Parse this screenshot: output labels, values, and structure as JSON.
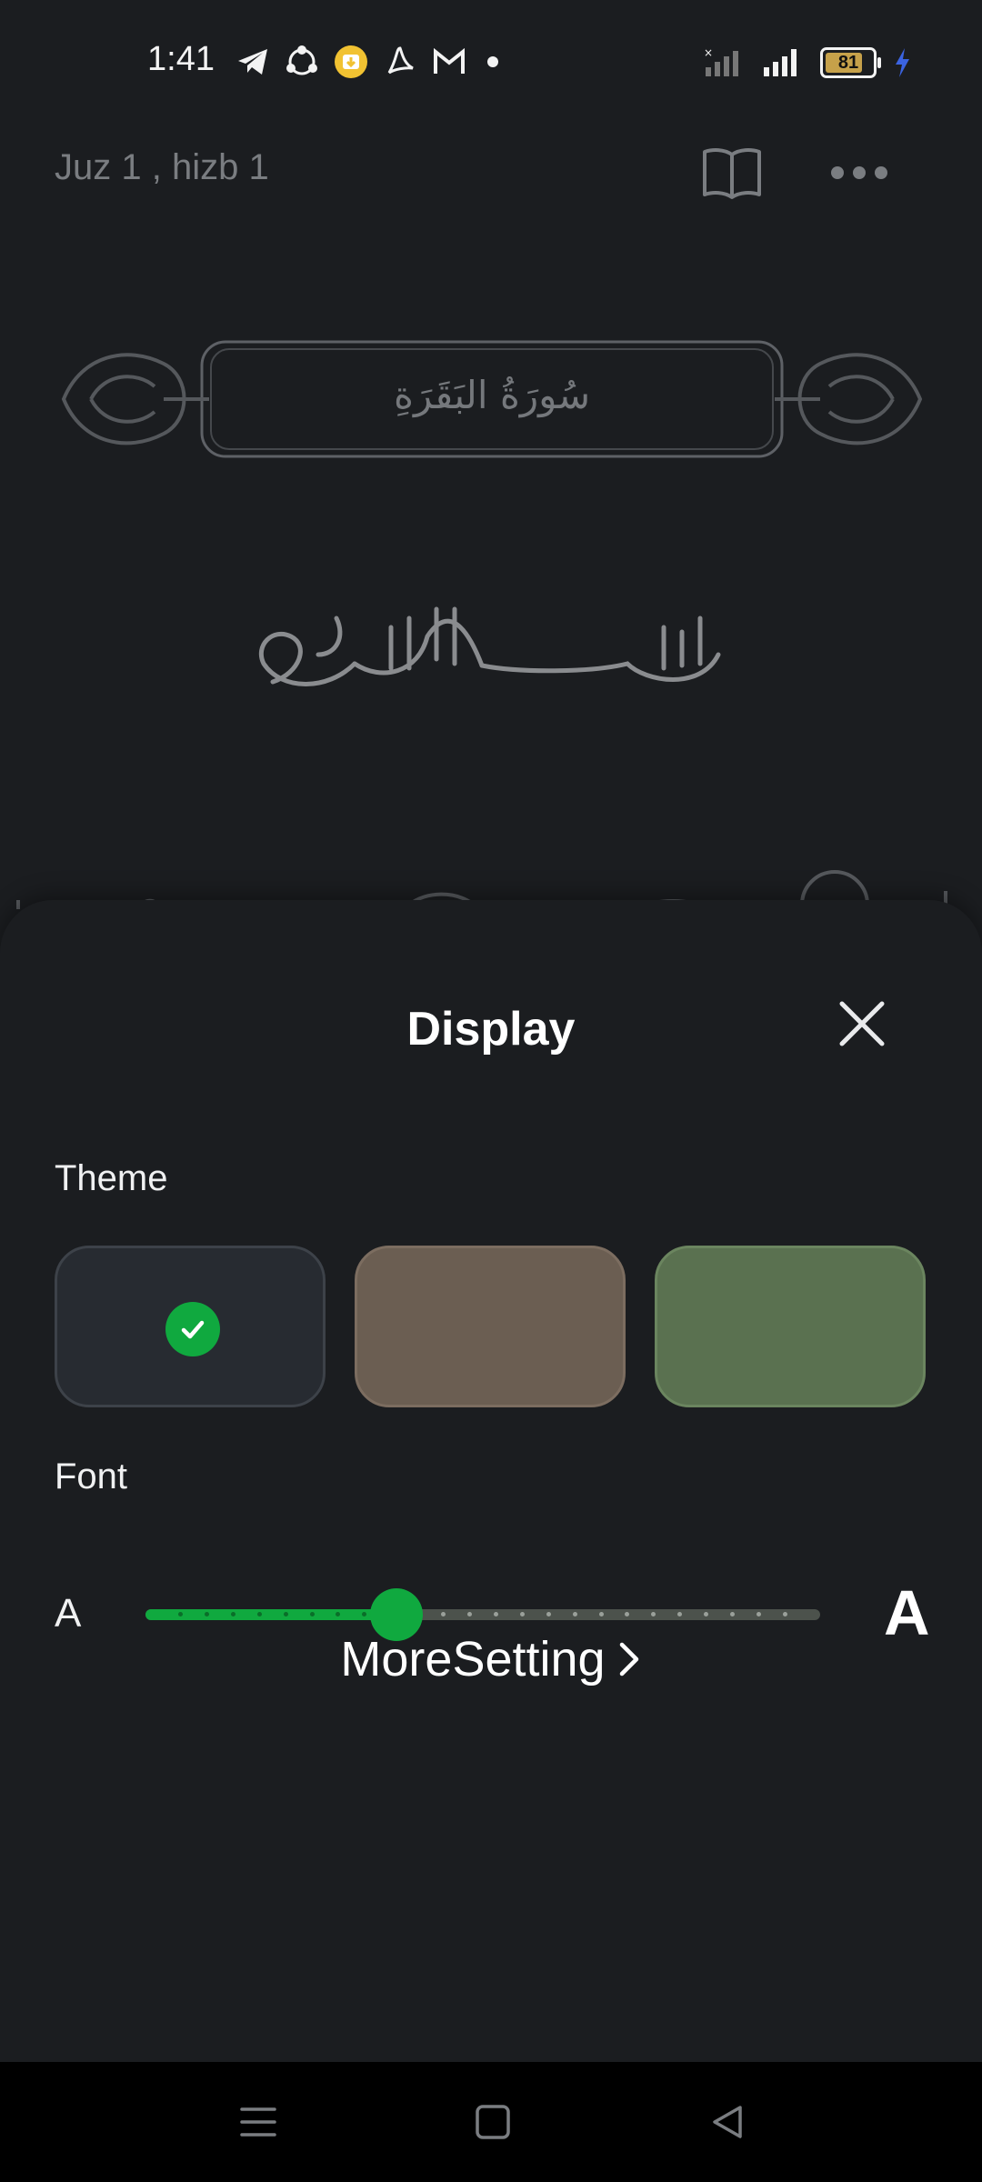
{
  "status_bar": {
    "time": "1:41",
    "notification_icons": [
      "telegram-icon",
      "share-icon",
      "download-icon",
      "acrobat-icon",
      "gmail-icon",
      "more-dot-icon"
    ],
    "battery_level": "81",
    "charging": true
  },
  "header": {
    "title": "Juz 1 , hizb 1",
    "book_icon": "open-book-icon",
    "menu_icon": "more-horizontal-icon"
  },
  "page": {
    "surah_name": "سُورَةُ البَقَرَةِ"
  },
  "display_sheet": {
    "title": "Display",
    "theme_label": "Theme",
    "themes": [
      {
        "name": "dark",
        "color": "#272b31",
        "selected": true
      },
      {
        "name": "brown",
        "color": "#6b5e52",
        "selected": false
      },
      {
        "name": "green",
        "color": "#5a7150",
        "selected": false
      }
    ],
    "font_label": "Font",
    "font_small_glyph": "A",
    "font_large_glyph": "A",
    "font_size_level": 0.372,
    "font_steps": 24,
    "more_setting_label": "MoreSetting"
  },
  "colors": {
    "accent": "#10a93f",
    "background": "#1b1d20",
    "muted_text": "#7a7d81"
  }
}
